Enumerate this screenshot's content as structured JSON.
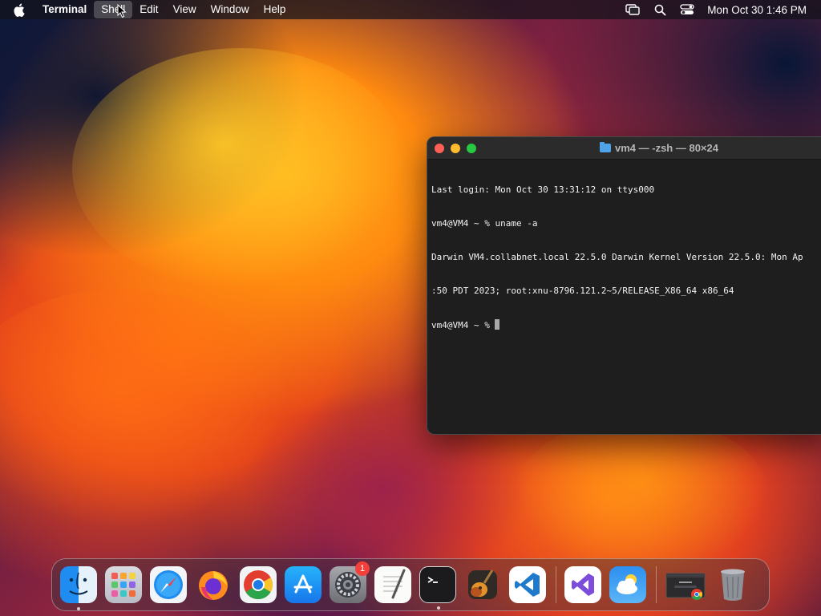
{
  "menubar": {
    "app_name": "Terminal",
    "items": [
      "Shell",
      "Edit",
      "View",
      "Window",
      "Help"
    ],
    "active_item": "Shell",
    "clock": "Mon Oct 30  1:46 PM",
    "status_icons": [
      "screen-mirroring-icon",
      "search-icon",
      "control-center-icon"
    ]
  },
  "terminal": {
    "title": "vm4 — -zsh — 80×24",
    "lines": [
      "Last login: Mon Oct 30 13:31:12 on ttys000",
      "vm4@VM4 ~ % uname -a",
      "Darwin VM4.collabnet.local 22.5.0 Darwin Kernel Version 22.5.0: Mon Ap",
      ":50 PDT 2023; root:xnu-8796.121.2~5/RELEASE_X86_64 x86_64",
      "vm4@VM4 ~ % "
    ]
  },
  "dock": {
    "items": [
      {
        "name": "finder-icon",
        "running": true
      },
      {
        "name": "launchpad-icon",
        "running": false
      },
      {
        "name": "safari-icon",
        "running": false
      },
      {
        "name": "firefox-icon",
        "running": false
      },
      {
        "name": "chrome-icon",
        "running": false
      },
      {
        "name": "app-store-icon",
        "running": false
      },
      {
        "name": "system-settings-icon",
        "running": false,
        "badge": "1"
      },
      {
        "name": "textedit-icon",
        "running": false
      },
      {
        "name": "terminal-icon",
        "running": true
      },
      {
        "name": "garageband-icon",
        "running": false
      },
      {
        "name": "vscode-icon",
        "running": false
      },
      {
        "name": "visual-studio-icon",
        "running": false
      },
      {
        "name": "weather-icon",
        "running": false
      },
      {
        "name": "chrome-window-icon",
        "running": false
      },
      {
        "name": "trash-icon",
        "running": false
      }
    ]
  },
  "colors": {
    "menubar_bg": "#14121a",
    "terminal_bg": "#1e1e1e",
    "traffic_red": "#fe5f57",
    "traffic_yellow": "#febc2e",
    "traffic_green": "#28c840"
  }
}
